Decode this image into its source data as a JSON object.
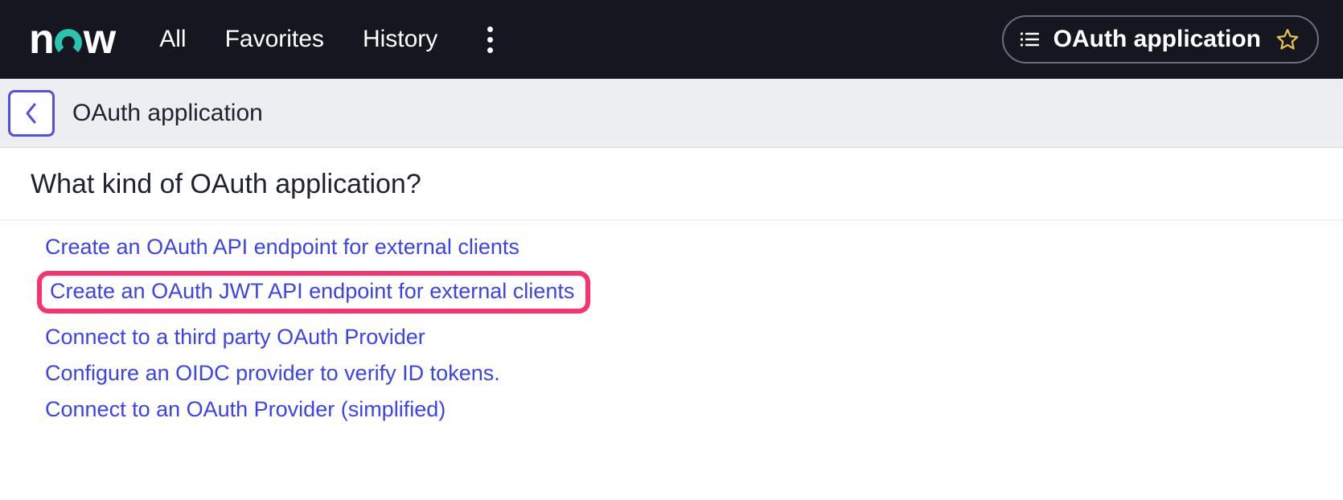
{
  "topbar": {
    "logo_text": "now",
    "nav": {
      "all": "All",
      "favorites": "Favorites",
      "history": "History"
    },
    "context_label": "OAuth application"
  },
  "subheader": {
    "title": "OAuth application"
  },
  "main": {
    "question": "What kind of OAuth application?",
    "options": [
      "Create an OAuth API endpoint for external clients",
      "Create an OAuth JWT API endpoint for external clients",
      "Connect to a third party OAuth Provider",
      "Configure an OIDC provider to verify ID tokens.",
      "Connect to an OAuth Provider (simplified)"
    ]
  }
}
